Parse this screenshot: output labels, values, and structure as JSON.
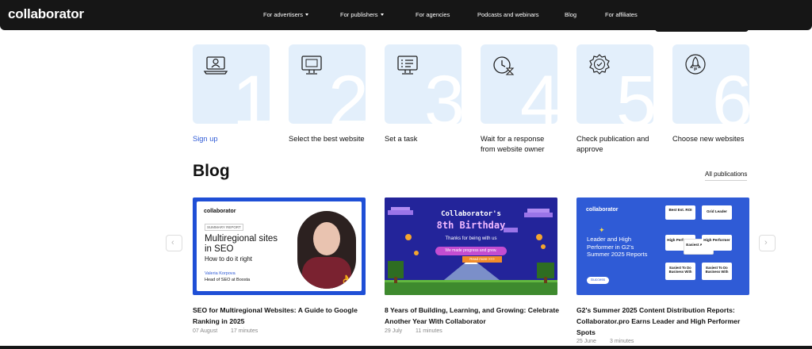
{
  "brand": {
    "logo": "collaborator"
  },
  "nav": {
    "items": [
      {
        "label": "For advertisers",
        "dropdown": true
      },
      {
        "label": "For publishers",
        "dropdown": true
      },
      {
        "label": "For agencies",
        "dropdown": false
      },
      {
        "label": "Podcasts and webinars",
        "dropdown": false
      },
      {
        "label": "Blog",
        "dropdown": false
      },
      {
        "label": "For affiliates",
        "dropdown": false
      }
    ]
  },
  "steps": [
    {
      "number": "1",
      "label": "Sign up",
      "icon": "laptop-user-icon"
    },
    {
      "number": "2",
      "label": "Select the best website",
      "icon": "monitor-icon"
    },
    {
      "number": "3",
      "label": "Set a task",
      "icon": "checklist-monitor-icon"
    },
    {
      "number": "4",
      "label": "Wait for a response from website owner",
      "icon": "clock-hourglass-icon"
    },
    {
      "number": "5",
      "label": "Check publication and approve",
      "icon": "badge-check-icon"
    },
    {
      "number": "6",
      "label": "Choose new websites",
      "icon": "rocket-icon"
    }
  ],
  "blog": {
    "title": "Blog",
    "all_link": "All publications",
    "posts": [
      {
        "title": "SEO for Multiregional Websites: A Guide to Google Ranking in 2025",
        "date": "07 August",
        "read_time": "17 minutes",
        "image": {
          "logo": "collaborator",
          "tag": "SUMMARY REPORT",
          "headline": "Multiregional sites in SEO",
          "sub": "How to do it right",
          "author": "Valeria Korpova",
          "role": "Head of SEO at Boosta"
        }
      },
      {
        "title": "8 Years of Building, Learning, and Growing: Celebrate Another Year With Collaborator",
        "date": "29 July",
        "read_time": "11 minutes",
        "image": {
          "heading1": "Collaborator's",
          "heading2": "8th Birthday",
          "thanks": "Thanks for being with us",
          "pill": "We made progress and grew.",
          "button": "Read more >>>"
        }
      },
      {
        "title": "G2's Summer 2025 Content Distribution Reports: Collaborator.pro Earns Leader and High Performer Spots",
        "date": "25 June",
        "read_time": "3 minutes",
        "image": {
          "logo": "collaborator",
          "headline": "Leader and High Performer in G2's Summer 2025 Reports",
          "pill": "Success",
          "badges": [
            "Best Est. ROI",
            "Grid Leader",
            "High Performer",
            "Easiest Admin",
            "High Performer",
            "Easiest To Do Business With",
            "Easiest To Do Business With"
          ]
        }
      }
    ]
  },
  "colors": {
    "nav_bg": "#161616",
    "step_bg": "#e3effb",
    "link": "#2f5bd6",
    "card_blue": "#1f4fd6"
  }
}
